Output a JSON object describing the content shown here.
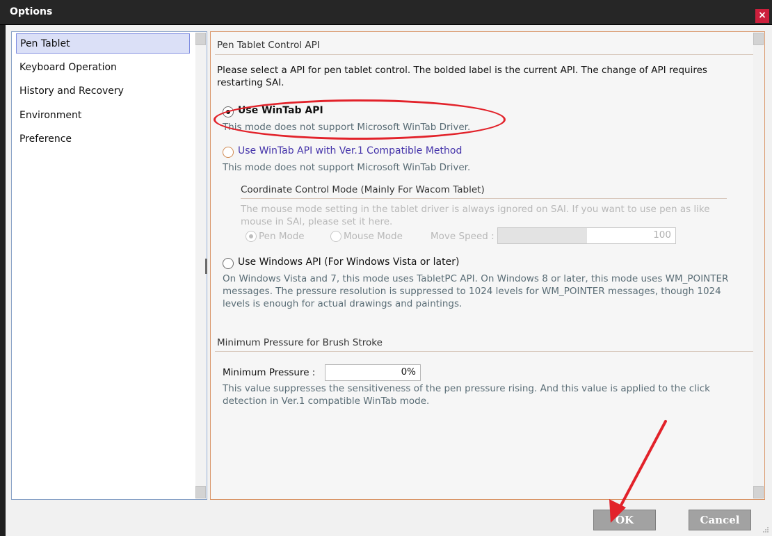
{
  "window": {
    "title": "Options",
    "close_glyph": "×"
  },
  "sidebar": {
    "items": [
      {
        "label": "Pen Tablet",
        "selected": true
      },
      {
        "label": "Keyboard Operation"
      },
      {
        "label": "History and Recovery"
      },
      {
        "label": "Environment"
      },
      {
        "label": "Preference"
      }
    ]
  },
  "pen_tablet": {
    "section_title": "Pen Tablet Control API",
    "intro_line1": "Please select a API for pen tablet control. The bolded label is the current API. The change of API requires",
    "intro_line2": "restarting SAI.",
    "options": {
      "wintab": {
        "label": "Use WinTab API",
        "desc": "This mode does not support Microsoft WinTab Driver.",
        "checked": true
      },
      "wintab_v1": {
        "label": "Use WinTab API with Ver.1 Compatible Method",
        "desc": "This mode does not support Microsoft WinTab Driver."
      },
      "windows": {
        "label": "Use Windows API (For Windows Vista or later)",
        "desc_line1": "On Windows Vista and 7, this mode uses TabletPC API. On Windows 8 or later, this mode uses WM_POINTER",
        "desc_line2": "messages. The pressure resolution is suppressed to 1024 levels for WM_POINTER messages, though 1024",
        "desc_line3": "levels is enough for actual drawings and paintings."
      }
    },
    "coordinate": {
      "title": "Coordinate Control Mode (Mainly For Wacom Tablet)",
      "desc_line1": "The mouse mode setting in the tablet driver is always ignored on SAI. If you want to use pen as like",
      "desc_line2": "mouse in SAI, please set it here.",
      "pen_mode": "Pen Mode",
      "mouse_mode": "Mouse Mode",
      "move_speed_label": "Move Speed :",
      "move_speed_value": "100",
      "move_speed_fraction": 0.5
    }
  },
  "min_pressure": {
    "section_title": "Minimum Pressure for Brush Stroke",
    "label": "Minimum Pressure :",
    "value": "0%",
    "desc_line1": "This value suppresses the sensitiveness of the pen pressure rising. And this value is applied to the click",
    "desc_line2": "detection in Ver.1 compatible WinTab mode."
  },
  "buttons": {
    "ok": "OK",
    "cancel": "Cancel"
  },
  "colors": {
    "accent_red": "#e2222a",
    "close_red": "#cc1f3c",
    "selection_bg": "#dbe0f7",
    "panel_border": "#d9976a",
    "link_purple": "#4433aa"
  }
}
